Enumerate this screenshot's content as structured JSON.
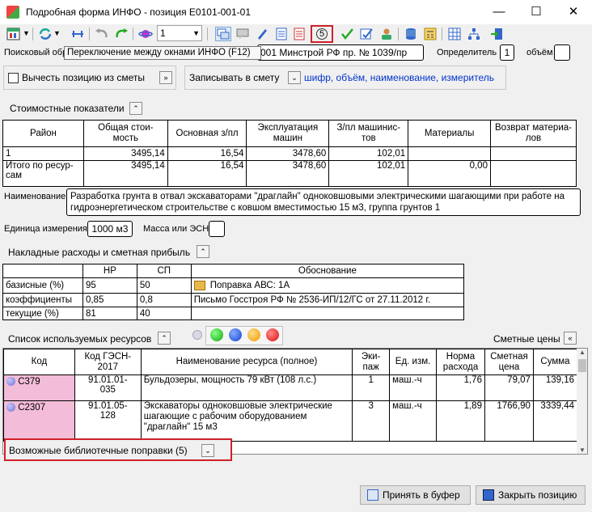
{
  "window": {
    "title": "Подробная форма ИНФО - позиция E0101-001-01",
    "minimize": "—",
    "maximize": "☐",
    "close": "✕"
  },
  "toolbar": {
    "combo_value": "1",
    "badge": "5",
    "tooltip": "Переключение между окнами ИНФО (F12)"
  },
  "search": {
    "label": "Поисковый обр",
    "value": "001 Минстрой РФ пр. № 1039/пр",
    "qualifier_label": "Определитель",
    "qualifier_value": "1",
    "volume_label": "объём",
    "volume_value": ""
  },
  "options": {
    "deduct_label": "Вычесть позицию из сметы",
    "deduct_btn": "»",
    "write_label": "Записывать в смету",
    "write_value": "шифр, объём, наименование, измеритель"
  },
  "cost": {
    "section_label": "Стоимостные показатели",
    "headers": [
      "Район",
      "Общая стои-\nмость",
      "Основная з/пл",
      "Эксплуатация\nмашин",
      "З/пл машинис-\nтов",
      "Материалы",
      "Возврат материа-\nлов"
    ],
    "rows": [
      [
        "1",
        "3495,14",
        "16,54",
        "3478,60",
        "102,01",
        "",
        ""
      ],
      [
        "Итого по ресур-\nсам",
        "3495,14",
        "16,54",
        "3478,60",
        "102,01",
        "0,00",
        ""
      ]
    ]
  },
  "naming": {
    "label": "Наименование",
    "value": "Разработка грунта в отвал экскаваторами \"драглайн\" одноковшовыми электрическими шагающими при работе на гидроэнергетическом строительстве с ковшом вместимостью 15 м3, группа грунтов 1"
  },
  "unit": {
    "label": "Единица измерения",
    "value": "1000 м3",
    "mass_label": "Масса или ЭСН",
    "mass_value": ""
  },
  "overhead": {
    "section_label": "Накладные расходы и сметная прибыль",
    "headers": [
      "",
      "НР",
      "СП",
      "Обоснование"
    ],
    "rows": [
      [
        "базисные (%)",
        "95",
        "50",
        "Поправка АВС: 1А"
      ],
      [
        "коэффициенты",
        "0,85",
        "0,8",
        "Письмо Госстроя РФ № 2536-ИП/12/ГС от 27.11.2012 г."
      ],
      [
        "текущие (%)",
        "81",
        "40",
        ""
      ]
    ]
  },
  "resources": {
    "section_label": "Список используемых ресурсов",
    "prices_label": "Сметные цены",
    "prices_btn": "«",
    "headers": [
      "Код",
      "Код ГЭСН-\n2017",
      "Наименование ресурса (полное)",
      "Эки-\nпаж",
      "Ед. изм.",
      "Норма\nрасхода",
      "Сметная\nцена",
      "Сумма"
    ],
    "rows": [
      [
        "С379",
        "91.01.01-\n035",
        "Бульдозеры, мощность 79 кВт (108 л.с.)",
        "1",
        "маш.-ч",
        "1,76",
        "79,07",
        "139,16"
      ],
      [
        "С2307",
        "91.01.05-\n128",
        "Экскаваторы одноковшовые электрические шагающие с рабочим оборудованием \"драглайн\" 15 м3",
        "3",
        "маш.-ч",
        "1,89",
        "1766,90",
        "3339,44"
      ]
    ]
  },
  "library": {
    "label": "Возможные библиотечные поправки (5)"
  },
  "buttons": {
    "accept": "Принять в буфер",
    "close": "Закрыть позицию"
  },
  "colors": {
    "code_cell": "#f3bcd8",
    "link": "#0033cc",
    "highlight": "#d0202a"
  }
}
